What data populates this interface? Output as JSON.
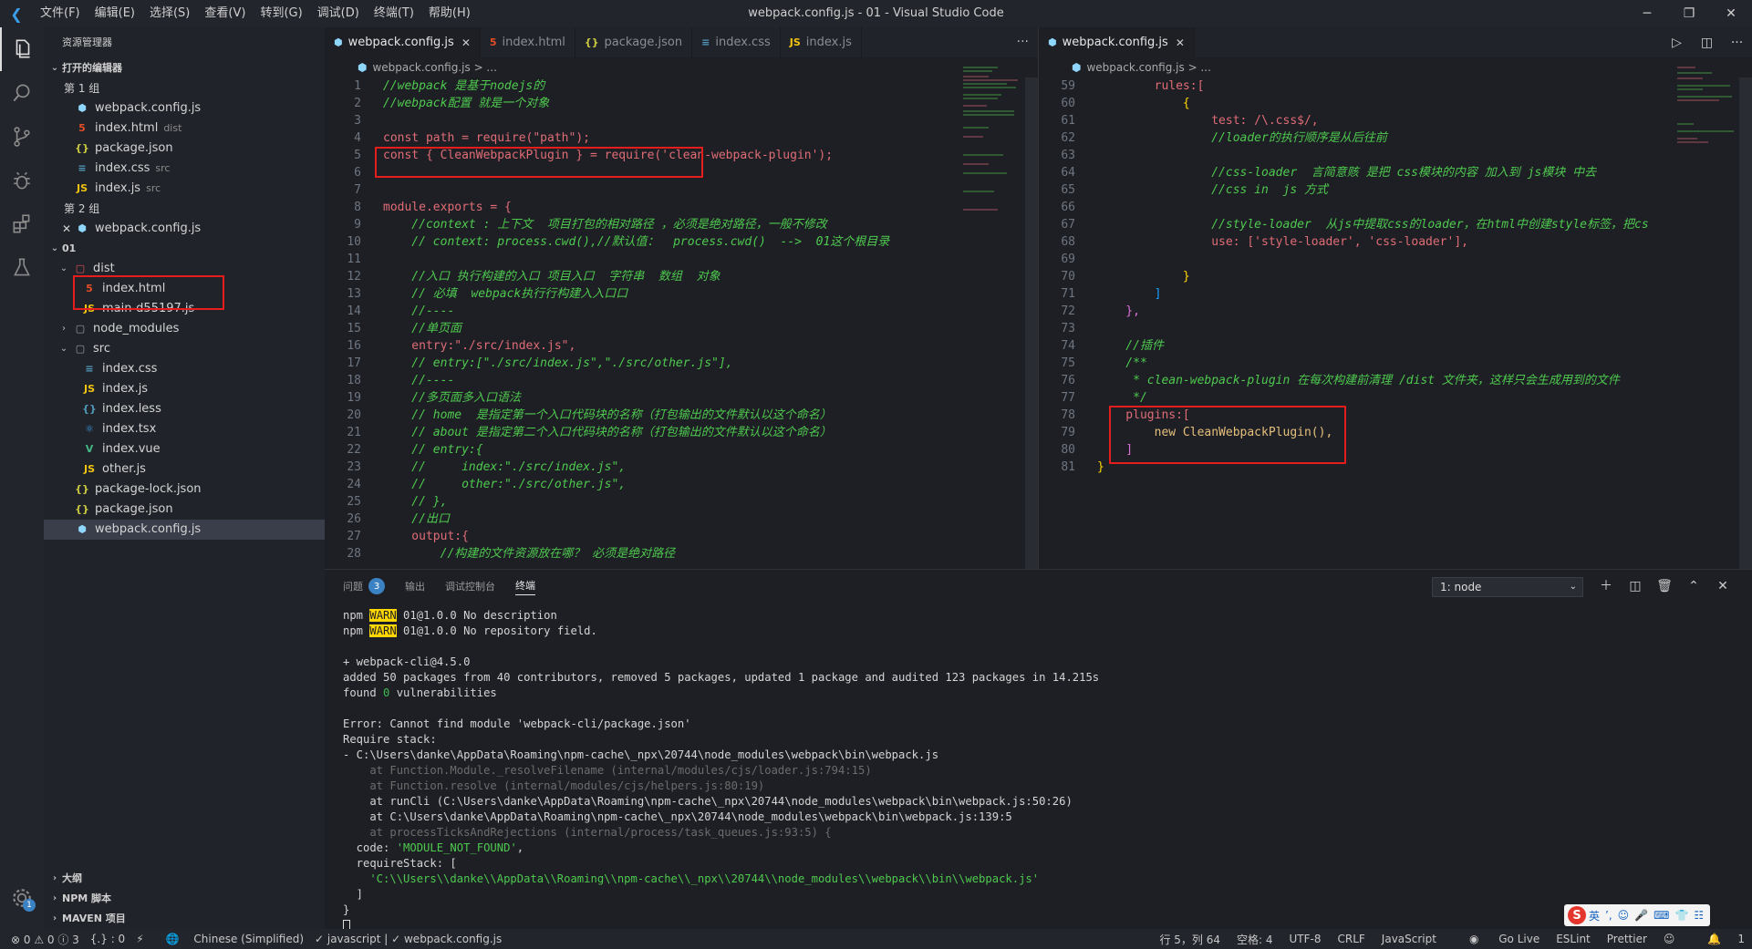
{
  "titlebar": {
    "menus": [
      "文件(F)",
      "编辑(E)",
      "选择(S)",
      "查看(V)",
      "转到(G)",
      "调试(D)",
      "终端(T)",
      "帮助(H)"
    ],
    "title": "webpack.config.js - 01 - Visual Studio Code",
    "minimize": "─",
    "maximize": "❐",
    "close": "✕"
  },
  "sidebar": {
    "header": "资源管理器",
    "open_editors": {
      "label": "打开的编辑器",
      "group1": "第 1 组",
      "group1_files": [
        {
          "name": "webpack.config.js",
          "desc": "",
          "icon": "webpack-icon"
        },
        {
          "name": "index.html",
          "desc": "dist",
          "icon": "html-icon"
        },
        {
          "name": "package.json",
          "desc": "",
          "icon": "json-icon"
        },
        {
          "name": "index.css",
          "desc": "src",
          "icon": "css-icon"
        },
        {
          "name": "index.js",
          "desc": "src",
          "icon": "js-icon"
        }
      ],
      "group2": "第 2 组",
      "group2_files": [
        {
          "name": "webpack.config.js",
          "desc": "",
          "icon": "webpack-icon"
        }
      ]
    },
    "project": {
      "label": "01",
      "dist": "dist",
      "dist_files": [
        "index.html",
        "main-d55197.js"
      ],
      "node_modules": "node_modules",
      "src": "src",
      "src_files": [
        "index.css",
        "index.js",
        "index.less",
        "index.tsx",
        "index.vue",
        "other.js"
      ],
      "root_files": [
        "package-lock.json",
        "package.json",
        "webpack.config.js"
      ]
    },
    "bottom_sections": [
      "大纲",
      "NPM 脚本",
      "MAVEN 项目"
    ]
  },
  "editor1": {
    "tabs": [
      {
        "label": "webpack.config.js",
        "active": true
      },
      {
        "label": "index.html",
        "active": false
      },
      {
        "label": "package.json",
        "active": false
      },
      {
        "label": "index.css",
        "active": false
      },
      {
        "label": "index.js",
        "active": false
      }
    ],
    "breadcrumb": "webpack.config.js > ...",
    "more": "···",
    "lines": [
      {
        "n": "1",
        "t": "//webpack 是基于nodejs的"
      },
      {
        "n": "2",
        "t": "//webpack配置 就是一个对象"
      },
      {
        "n": "3",
        "t": ""
      },
      {
        "n": "4",
        "t": "const path = require(\"path\");"
      },
      {
        "n": "5",
        "t": "const { CleanWebpackPlugin } = require('clean-webpack-plugin');"
      },
      {
        "n": "6",
        "t": ""
      },
      {
        "n": "7",
        "t": ""
      },
      {
        "n": "8",
        "t": "module.exports = {"
      },
      {
        "n": "9",
        "t": "    //context : 上下文  项目打包的相对路径 ，必须是绝对路径，一般不修改"
      },
      {
        "n": "10",
        "t": "    // context: process.cwd(),//默认值：  process.cwd()  -->  01这个根目录"
      },
      {
        "n": "11",
        "t": ""
      },
      {
        "n": "12",
        "t": "    //入口 执行构建的入口 项目入口  字符串  数组  对象"
      },
      {
        "n": "13",
        "t": "    // 必填  webpack执行行构建入入口口"
      },
      {
        "n": "14",
        "t": "    //----"
      },
      {
        "n": "15",
        "t": "    //单页面"
      },
      {
        "n": "16",
        "t": "    entry:\"./src/index.js\","
      },
      {
        "n": "17",
        "t": "    // entry:[\"./src/index.js\",\"./src/other.js\"],"
      },
      {
        "n": "18",
        "t": "    //----"
      },
      {
        "n": "19",
        "t": "    //多页面多入口语法"
      },
      {
        "n": "20",
        "t": "    // home  是指定第一个入口代码块的名称（打包输出的文件默认以这个命名）"
      },
      {
        "n": "21",
        "t": "    // about 是指定第二个入口代码块的名称（打包输出的文件默认以这个命名）"
      },
      {
        "n": "22",
        "t": "    // entry:{"
      },
      {
        "n": "23",
        "t": "    //     index:\"./src/index.js\","
      },
      {
        "n": "24",
        "t": "    //     other:\"./src/other.js\","
      },
      {
        "n": "25",
        "t": "    // },"
      },
      {
        "n": "26",
        "t": "    //出口"
      },
      {
        "n": "27",
        "t": "    output:{"
      },
      {
        "n": "28",
        "t": "        //构建的文件资源放在哪？ 必须是绝对路径"
      }
    ]
  },
  "editor2": {
    "tab": "webpack.config.js",
    "breadcrumb": "webpack.config.js > ...",
    "lines": [
      {
        "n": "59",
        "t": "        rules:["
      },
      {
        "n": "60",
        "t": "            {"
      },
      {
        "n": "61",
        "t": "                test: /\\.css$/,"
      },
      {
        "n": "62",
        "t": "                //loader的执行顺序是从后往前"
      },
      {
        "n": "63",
        "t": ""
      },
      {
        "n": "64",
        "t": "                //css-loader  言简意赅 是把 css模块的内容 加入到 js模块 中去"
      },
      {
        "n": "65",
        "t": "                //css in  js 方式"
      },
      {
        "n": "66",
        "t": ""
      },
      {
        "n": "67",
        "t": "                //style-loader  从js中提取css的loader，在html中创建style标签，把cs"
      },
      {
        "n": "68",
        "t": "                use: ['style-loader', 'css-loader'],"
      },
      {
        "n": "69",
        "t": ""
      },
      {
        "n": "70",
        "t": "            }"
      },
      {
        "n": "71",
        "t": "        ]"
      },
      {
        "n": "72",
        "t": "    },"
      },
      {
        "n": "73",
        "t": ""
      },
      {
        "n": "74",
        "t": "    //插件"
      },
      {
        "n": "75",
        "t": "    /**"
      },
      {
        "n": "76",
        "t": "     * clean-webpack-plugin 在每次构建前清理 /dist 文件夹，这样只会生成用到的文件"
      },
      {
        "n": "77",
        "t": "     */"
      },
      {
        "n": "78",
        "t": "    plugins:["
      },
      {
        "n": "79",
        "t": "        new CleanWebpackPlugin(),"
      },
      {
        "n": "80",
        "t": "    ]"
      },
      {
        "n": "81",
        "t": "}"
      }
    ]
  },
  "panel": {
    "tabs": {
      "problems": "问题",
      "problems_count": "3",
      "output": "输出",
      "debug": "调试控制台",
      "terminal": "终端"
    },
    "terminal_select": "1: node",
    "terminal_lines": {
      "l1a": "npm ",
      "l1w": "WARN",
      "l1b": " 01@1.0.0 No description",
      "l2a": "npm ",
      "l2w": "WARN",
      "l2b": " 01@1.0.0 No repository field.",
      "l3": "+ webpack-cli@4.5.0",
      "l4": "added 50 packages from 40 contributors, removed 5 packages, updated 1 package and audited 123 packages in 14.215s",
      "l5a": "found ",
      "l5b": "0",
      "l5c": " vulnerabilities",
      "l6": "Error: Cannot find module 'webpack-cli/package.json'",
      "l7": "Require stack:",
      "l8": "- C:\\Users\\danke\\AppData\\Roaming\\npm-cache\\_npx\\20744\\node_modules\\webpack\\bin\\webpack.js",
      "l9": "    at Function.Module._resolveFilename (internal/modules/cjs/loader.js:794:15)",
      "l10": "    at Function.resolve (internal/modules/cjs/helpers.js:80:19)",
      "l11": "    at runCli (C:\\Users\\danke\\AppData\\Roaming\\npm-cache\\_npx\\20744\\node_modules\\webpack\\bin\\webpack.js:50:26)",
      "l12": "    at C:\\Users\\danke\\AppData\\Roaming\\npm-cache\\_npx\\20744\\node_modules\\webpack\\bin\\webpack.js:139:5",
      "l13": "    at processTicksAndRejections (internal/process/task_queues.js:93:5) {",
      "l14a": "  code: ",
      "l14b": "'MODULE_NOT_FOUND'",
      "l14c": ",",
      "l15": "  requireStack: [",
      "l16": "    'C:\\\\Users\\\\danke\\\\AppData\\\\Roaming\\\\npm-cache\\\\_npx\\\\20744\\\\node_modules\\\\webpack\\\\bin\\\\webpack.js'",
      "l17": "  ]",
      "l18": "}"
    }
  },
  "statusbar": {
    "errors": "⊗ 0 ⚠ 0 ⓘ 3",
    "braces": "{.} : 0",
    "lang_pack": "Chinese (Simplified)",
    "linter": "✓ javascript | ✓ webpack.config.js",
    "position": "行 5，列 64",
    "spaces": "空格: 4",
    "encoding": "UTF-8",
    "eol": "CRLF",
    "language": "JavaScript",
    "golive": "Go Live",
    "eslint": "ESLint",
    "prettier": "Prettier",
    "bell": "1"
  },
  "ime": {
    "label": "英"
  },
  "colors": {
    "accent": "#3b82c4",
    "highlight_box": "#e51d1d",
    "warn": "#ffd700"
  }
}
